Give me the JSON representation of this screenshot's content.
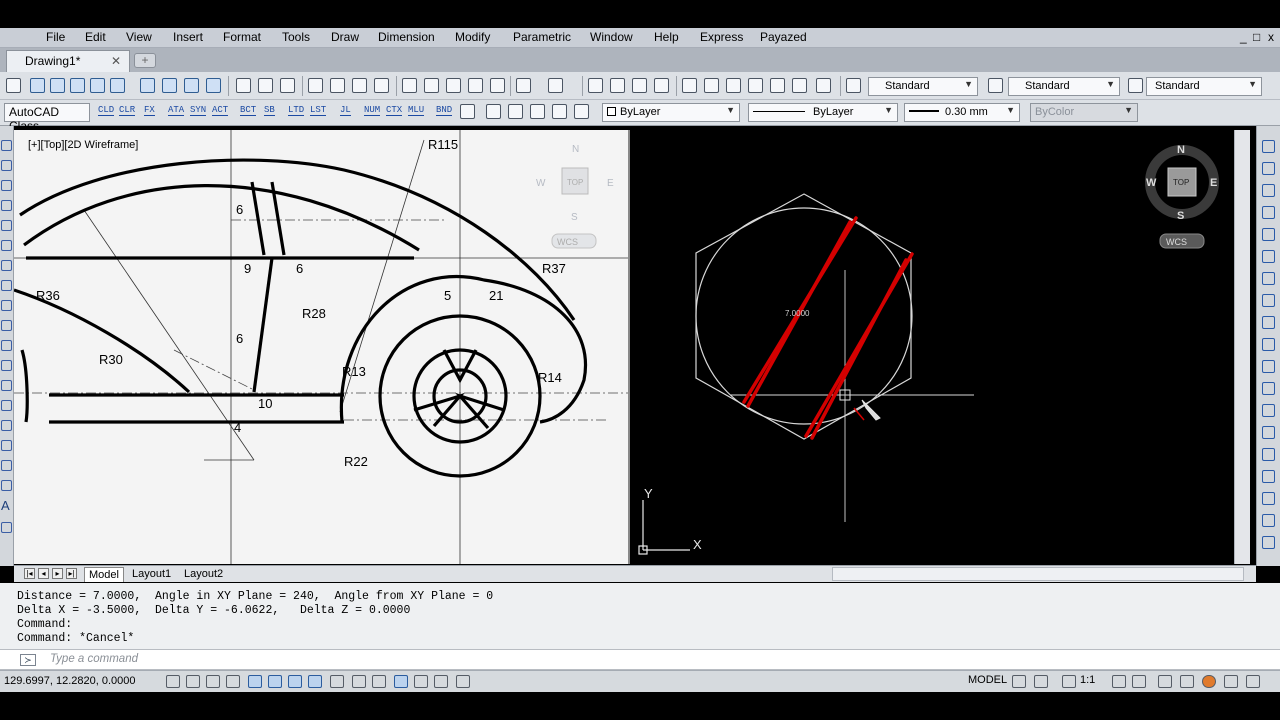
{
  "app": {
    "document_tab": "Drawing1*",
    "window_controls": [
      "_",
      "□",
      "x"
    ]
  },
  "menu": [
    "File",
    "Edit",
    "View",
    "Insert",
    "Format",
    "Tools",
    "Draw",
    "Dimension",
    "Modify",
    "Parametric",
    "Window",
    "Help",
    "Express",
    "Payazed"
  ],
  "toolbar": {
    "text_style": "Standard",
    "dim_style": "Standard",
    "table_style": "Standard",
    "workspace": "AutoCAD Class",
    "express_buttons": [
      "CLD",
      "CLR",
      "FX",
      "ATA",
      "SYN",
      "ACT",
      "BCT",
      "SB",
      "LTD",
      "LST",
      "JL",
      "NUM",
      "CTX",
      "MLU",
      "BND"
    ],
    "layer": "ByLayer",
    "linetype": "ByLayer",
    "lineweight": "0.30 mm",
    "color": "ByColor"
  },
  "viewport": {
    "label": "[+][Top][2D Wireframe]",
    "viewcube_left": {
      "n": "N",
      "s": "S",
      "e": "E",
      "w": "W",
      "face": "TOP",
      "ucs": "WCS"
    },
    "viewcube_right": {
      "n": "N",
      "s": "S",
      "e": "E",
      "w": "W",
      "face": "TOP",
      "ucs": "WCS"
    },
    "dimension_text": "7.0000",
    "ucs_x": "X",
    "ucs_y": "Y"
  },
  "reference_drawing": {
    "labels": [
      "R115",
      "R37",
      "R36",
      "R30",
      "R28",
      "R13",
      "R14",
      "R22",
      "6",
      "9",
      "6",
      "6",
      "5",
      "21",
      "10",
      "4"
    ]
  },
  "layout_tabs": [
    "Model",
    "Layout1",
    "Layout2"
  ],
  "command_history": [
    "Distance = 7.0000,  Angle in XY Plane = 240,  Angle from XY Plane = 0",
    "Delta X = -3.5000,  Delta Y = -6.0622,   Delta Z = 0.0000",
    "Command:",
    "Command: *Cancel*"
  ],
  "command_input": {
    "placeholder": "Type a command"
  },
  "status": {
    "coordinates": "129.6997, 12.2820, 0.0000",
    "space": "MODEL",
    "annotation_scale": "1:1"
  },
  "colors": {
    "accent": "#d40000",
    "workspace_bg": "#000000",
    "paper_bg": "#f4f4f4"
  }
}
